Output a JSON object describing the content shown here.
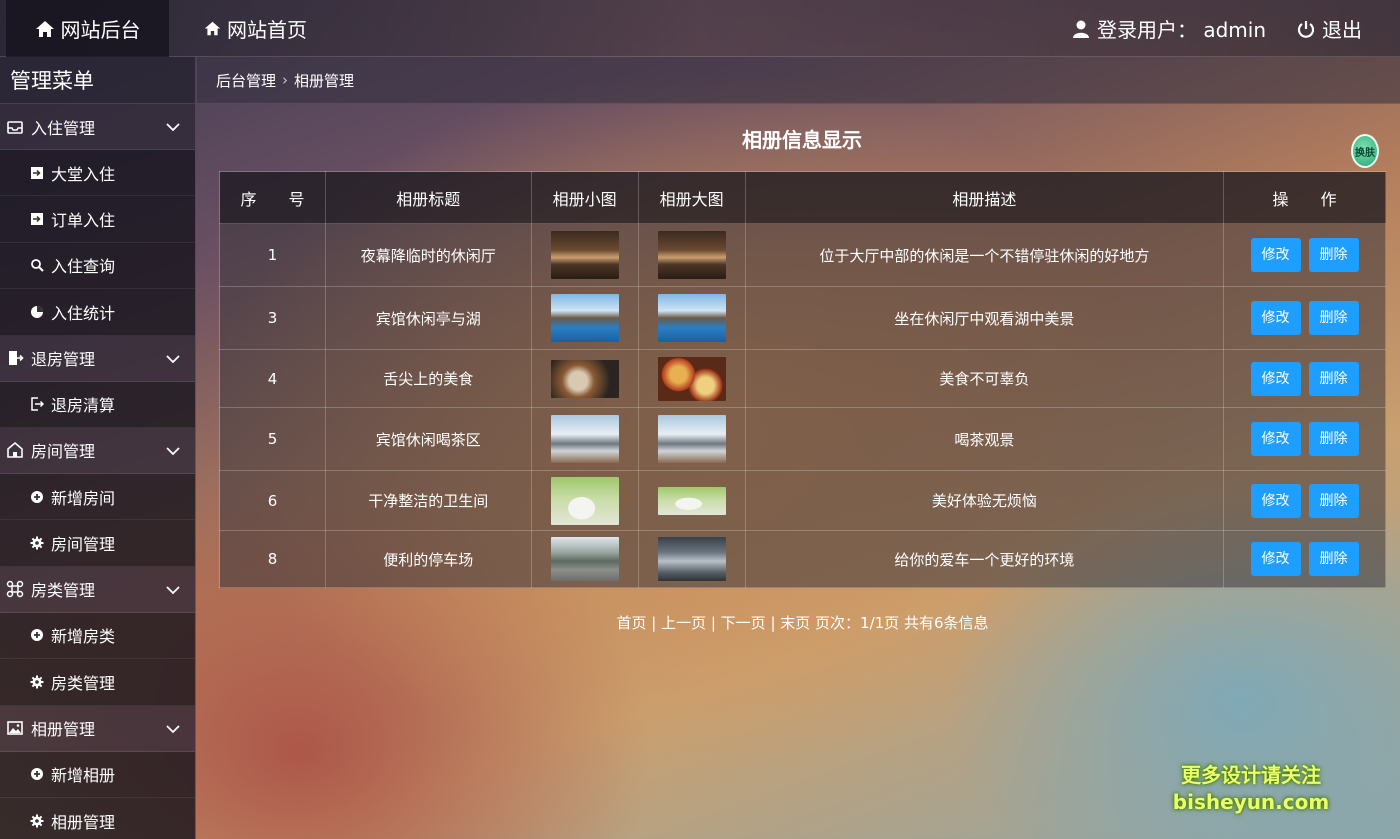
{
  "topbar": {
    "brand": "网站后台",
    "home": "网站首页",
    "user": "登录用户：  admin",
    "logout": "退出"
  },
  "sidebar": {
    "title": "管理菜单",
    "groups": [
      {
        "label": "入住管理",
        "items": [
          "大堂入住",
          "订单入住",
          "入住查询",
          "入住统计"
        ]
      },
      {
        "label": "退房管理",
        "items": [
          "退房清算"
        ]
      },
      {
        "label": "房间管理",
        "items": [
          "新增房间",
          "房间管理"
        ]
      },
      {
        "label": "房类管理",
        "items": [
          "新增房类",
          "房类管理"
        ]
      },
      {
        "label": "相册管理",
        "items": [
          "新增相册",
          "相册管理"
        ]
      }
    ]
  },
  "breadcrumb": {
    "root": "后台管理",
    "current": "相册管理"
  },
  "main": {
    "title": "相册信息显示",
    "skin": "换肤",
    "headers": [
      "序　　号",
      "相册标题",
      "相册小图",
      "相册大图",
      "相册描述",
      "操　　作"
    ],
    "rows": [
      {
        "id": "1",
        "title": "夜幕降临时的休闲厅",
        "desc": "位于大厅中部的休闲是一个不错停驻休闲的好地方"
      },
      {
        "id": "3",
        "title": "宾馆休闲亭与湖",
        "desc": "坐在休闲厅中观看湖中美景"
      },
      {
        "id": "4",
        "title": "舌尖上的美食",
        "desc": "美食不可辜负"
      },
      {
        "id": "5",
        "title": "宾馆休闲喝茶区",
        "desc": "喝茶观景"
      },
      {
        "id": "6",
        "title": "干净整洁的卫生间",
        "desc": "美好体验无烦恼"
      },
      {
        "id": "8",
        "title": "便利的停车场",
        "desc": "给你的爱车一个更好的环境"
      }
    ],
    "edit_label": "修改",
    "delete_label": "删除",
    "pager": "首页 | 上一页 | 下一页 | 末页  页次：1/1页 共有6条信息"
  },
  "watermark": {
    "line1": "更多设计请关注",
    "line2": "bisheyun.com"
  }
}
